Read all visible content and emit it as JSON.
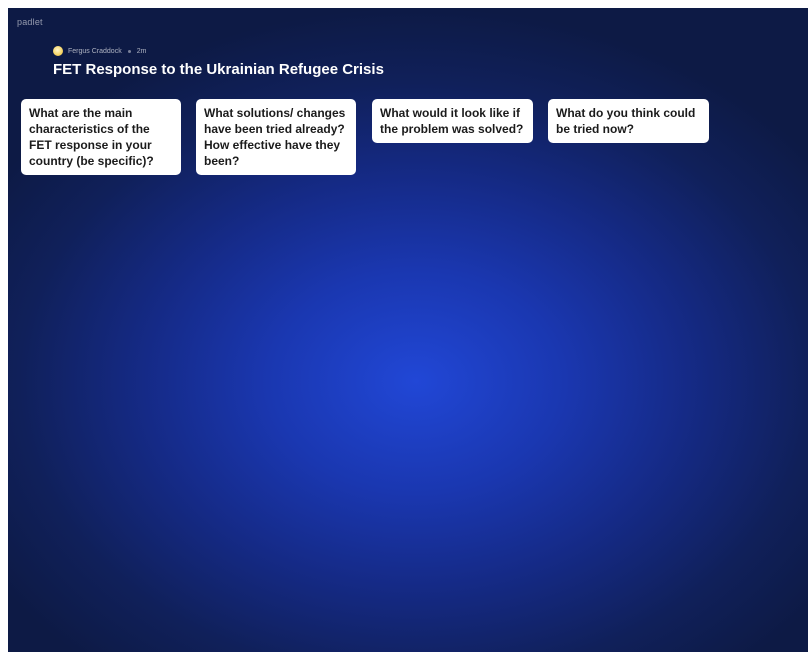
{
  "app": {
    "brand": "padlet"
  },
  "board": {
    "author": "Fergus Craddock",
    "time_ago": "2m",
    "title": "FET Response to the Ukrainian Refugee Crisis"
  },
  "columns": [
    {
      "heading": "What are the main characteristics of the FET response in your country (be specific)?"
    },
    {
      "heading": "What solutions/ changes have been tried already? How effective have they been?"
    },
    {
      "heading": "What would it look like if the problem was solved?"
    },
    {
      "heading": "What do you think could be tried now?"
    }
  ],
  "colors": {
    "background_center": "#2147d6",
    "background_edge": "#0d1a45",
    "card": "#ffffff",
    "avatar": "#f6d76b"
  },
  "icons": [
    "avatar"
  ]
}
